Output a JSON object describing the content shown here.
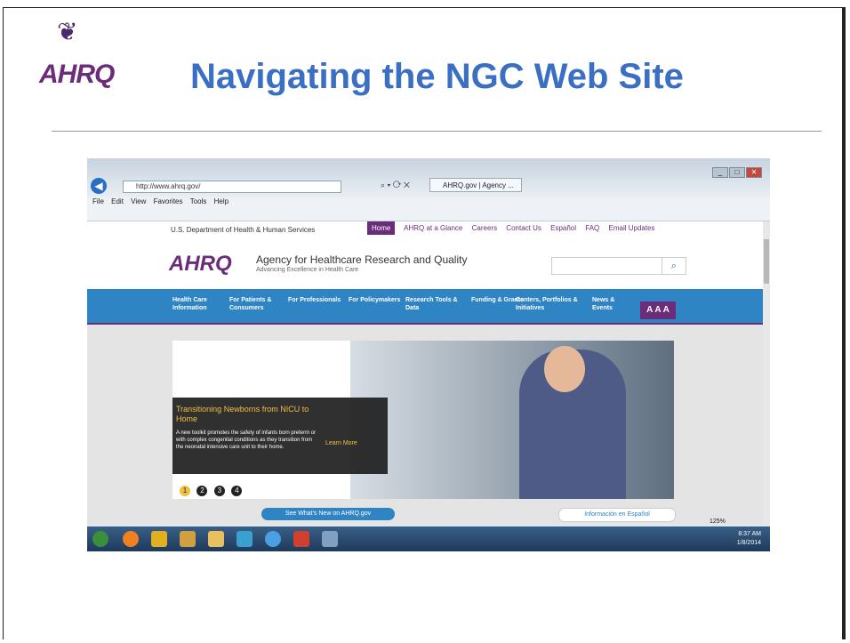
{
  "slide": {
    "title": "Navigating the NGC Web Site",
    "logo_text": "AHRQ"
  },
  "browser": {
    "address": "http://www.ahrq.gov/",
    "tab_title": "AHRQ.gov | Agency ...",
    "menu": [
      "File",
      "Edit",
      "View",
      "Favorites",
      "Tools",
      "Help"
    ],
    "zoom": "125%"
  },
  "site": {
    "hhs": "U.S. Department of Health & Human Services",
    "toplinks": [
      "Home",
      "AHRQ at a Glance",
      "Careers",
      "Contact Us",
      "Español",
      "FAQ",
      "Email Updates"
    ],
    "logo": "AHRQ",
    "agency_name": "Agency for Healthcare Research and Quality",
    "tagline": "Advancing Excellence in Health Care",
    "nav": [
      "Health Care Information",
      "For Patients & Consumers",
      "For Professionals",
      "For Policymakers",
      "Research Tools & Data",
      "Funding & Grants",
      "Centers, Portfolios & Initiatives",
      "News & Events"
    ],
    "text_size": "A A A",
    "hero": {
      "title": "Transitioning Newborns from NICU to Home",
      "body": "A new toolkit promotes the safety of infants born preterm or with complex congenital conditions as they transition from the neonatal intensive care unit to their home.",
      "learn_more": "Learn More",
      "dots": [
        "1",
        "2",
        "3",
        "4"
      ]
    },
    "btn_new": "See What's New on AHRQ.gov",
    "btn_es": "Información en Español"
  },
  "taskbar": {
    "time": "8:37 AM",
    "date": "1/8/2014"
  }
}
